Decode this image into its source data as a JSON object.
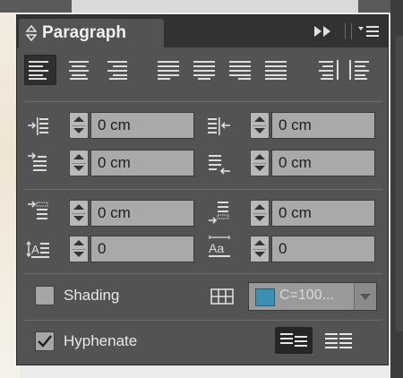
{
  "panel": {
    "title": "Paragraph",
    "collapse_icon": "up-down-arrows-icon",
    "expand_icon": "fast-forward-icon",
    "menu_icon": "panel-menu-icon"
  },
  "alignment": {
    "buttons": [
      {
        "name": "align-left",
        "selected": true
      },
      {
        "name": "align-center",
        "selected": false
      },
      {
        "name": "align-right",
        "selected": false
      },
      {
        "name": "justify-left",
        "selected": false
      },
      {
        "name": "justify-center",
        "selected": false
      },
      {
        "name": "justify-right",
        "selected": false
      },
      {
        "name": "justify-all",
        "selected": false
      },
      {
        "name": "align-towards-spine",
        "selected": false
      },
      {
        "name": "align-away-from-spine",
        "selected": false
      }
    ]
  },
  "indents": {
    "left_indent": "0 cm",
    "right_indent": "0 cm",
    "first_line_indent": "0 cm",
    "last_line_right_indent": "0 cm"
  },
  "spacing": {
    "space_before": "0 cm",
    "space_after": "0 cm",
    "drop_cap_lines": "0",
    "drop_cap_characters": "0"
  },
  "shading": {
    "label": "Shading",
    "checked": false,
    "color_value": "C=100...",
    "swatch_color": "#3e8fb4"
  },
  "hyphenate": {
    "label": "Hyphenate",
    "checked": true
  },
  "colors": {
    "panel_bg": "#535353",
    "titlebar_bg": "#323232",
    "field_bg": "#a9a9a9"
  }
}
